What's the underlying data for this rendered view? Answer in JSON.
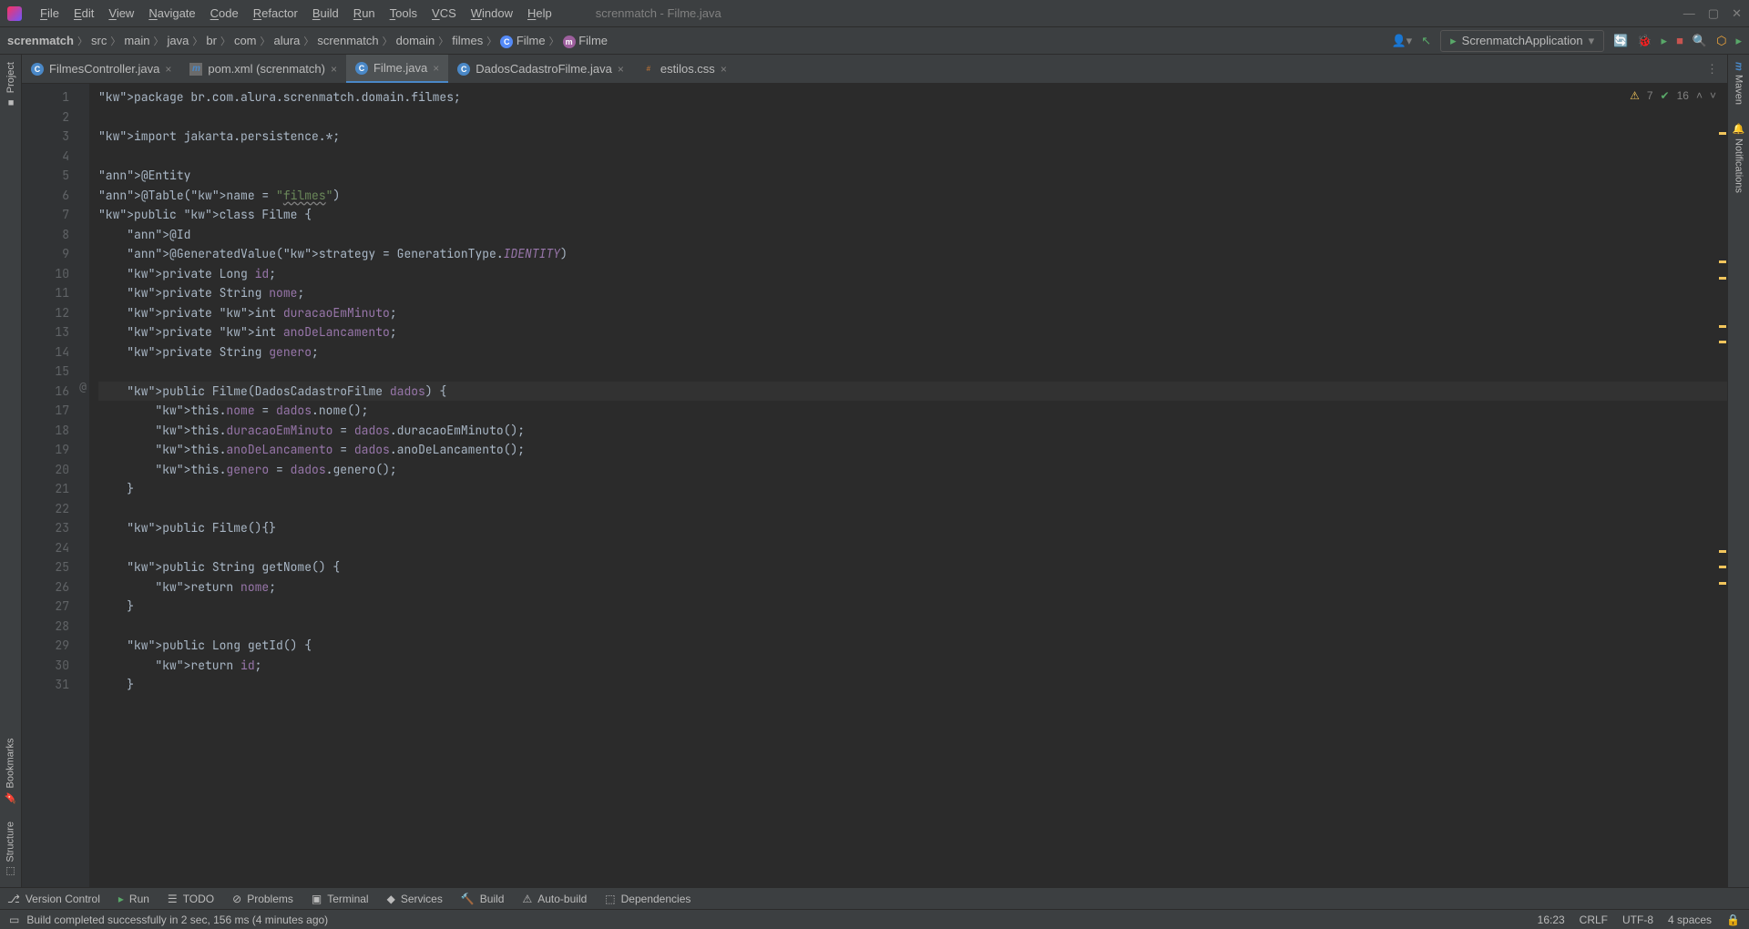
{
  "title": "screnmatch - Filme.java",
  "menu": [
    "File",
    "Edit",
    "View",
    "Navigate",
    "Code",
    "Refactor",
    "Build",
    "Run",
    "Tools",
    "VCS",
    "Window",
    "Help"
  ],
  "breadcrumb": [
    "screnmatch",
    "src",
    "main",
    "java",
    "br",
    "com",
    "alura",
    "screnmatch",
    "domain",
    "filmes",
    "Filme",
    "Filme"
  ],
  "runConfig": "ScrenmatchApplication",
  "tabs": [
    {
      "label": "FilmesController.java",
      "icon": "c"
    },
    {
      "label": "pom.xml (screnmatch)",
      "icon": "m"
    },
    {
      "label": "Filme.java",
      "icon": "c",
      "active": true
    },
    {
      "label": "DadosCadastroFilme.java",
      "icon": "c"
    },
    {
      "label": "estilos.css",
      "icon": "css"
    }
  ],
  "inspection": {
    "warnings": "7",
    "checks": "16"
  },
  "leftRail": [
    "Project",
    "Bookmarks",
    "Structure"
  ],
  "rightRail": [
    "Maven",
    "Notifications"
  ],
  "bottomTools": [
    "Version Control",
    "Run",
    "TODO",
    "Problems",
    "Terminal",
    "Services",
    "Build",
    "Auto-build",
    "Dependencies"
  ],
  "status": {
    "msg": "Build completed successfully in 2 sec, 156 ms (4 minutes ago)",
    "pos": "16:23",
    "eol": "CRLF",
    "enc": "UTF-8",
    "indent": "4 spaces"
  },
  "code": [
    "package br.com.alura.screnmatch.domain.filmes;",
    "",
    "import jakarta.persistence.*;",
    "",
    "@Entity",
    "@Table(name = \"filmes\")",
    "public class Filme {",
    "    @Id",
    "    @GeneratedValue(strategy = GenerationType.IDENTITY)",
    "    private Long id;",
    "    private String nome;",
    "    private int duracaoEmMinuto;",
    "    private int anoDeLancamento;",
    "    private String genero;",
    "",
    "    public Filme(DadosCadastroFilme dados) {",
    "        this.nome = dados.nome();",
    "        this.duracaoEmMinuto = dados.duracaoEmMinuto();",
    "        this.anoDeLancamento = dados.anoDeLancamento();",
    "        this.genero = dados.genero();",
    "    }",
    "",
    "    public Filme(){}",
    "",
    "    public String getNome() {",
    "        return nome;",
    "    }",
    "",
    "    public Long getId() {",
    "        return id;",
    "    }"
  ]
}
